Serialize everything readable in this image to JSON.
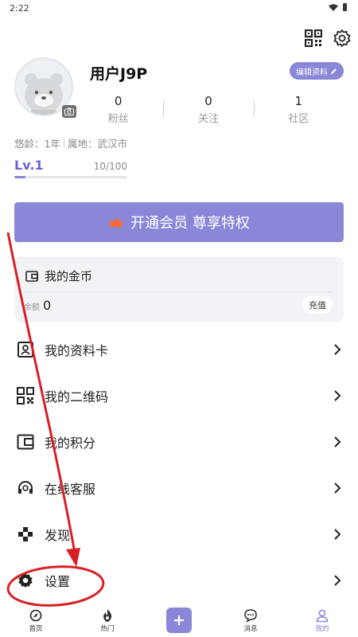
{
  "status_bar": {
    "time": "2:22"
  },
  "profile": {
    "username": "用户J9P",
    "edit_label": "编辑资料",
    "stats": [
      {
        "value": "0",
        "label": "粉丝"
      },
      {
        "value": "0",
        "label": "关注"
      },
      {
        "value": "1",
        "label": "社区"
      }
    ],
    "age_text": "悠龄：1年",
    "location_text": "属地：武汉市",
    "level": {
      "name": "Lv.1",
      "exp": "10/100",
      "progress": 0.1
    }
  },
  "vip_banner": {
    "label": "开通会员 尊享特权",
    "crown_icon": "crown-icon"
  },
  "coins": {
    "title": "我的金币",
    "balance_label": "余额",
    "balance_value": "0",
    "recharge_label": "充值"
  },
  "menu": [
    {
      "label": "我的资料卡",
      "icon": "profile-card-icon"
    },
    {
      "label": "我的二维码",
      "icon": "qr-code-icon"
    },
    {
      "label": "我的积分",
      "icon": "wallet-icon"
    },
    {
      "label": "在线客服",
      "icon": "headset-icon"
    },
    {
      "label": "发现",
      "icon": "gamepad-icon"
    },
    {
      "label": "设置",
      "icon": "gear-icon"
    }
  ],
  "bottom_nav": [
    {
      "label": "首页",
      "icon": "home-icon"
    },
    {
      "label": "热门",
      "icon": "fire-icon"
    },
    {
      "label": "",
      "icon": "plus-icon"
    },
    {
      "label": "消息",
      "icon": "message-icon"
    },
    {
      "label": "我的",
      "icon": "user-icon"
    }
  ],
  "colors": {
    "accent": "#8a86d8",
    "annotation": "#d81f26"
  }
}
